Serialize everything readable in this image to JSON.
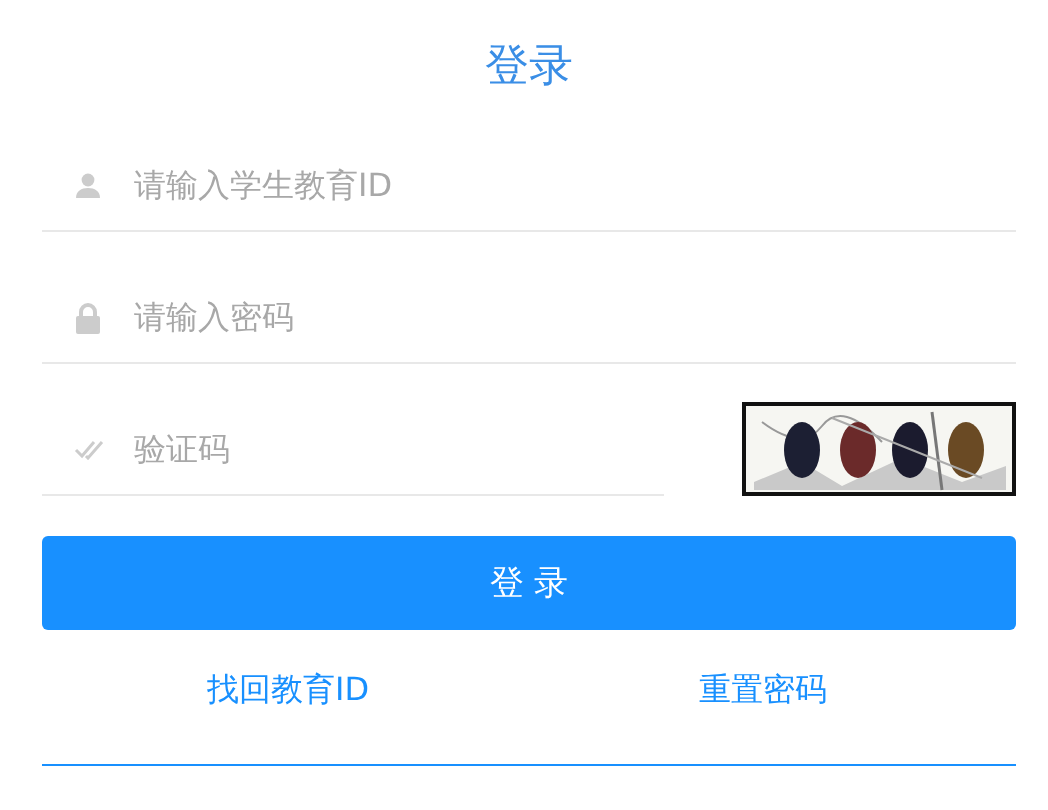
{
  "title": "登录",
  "fields": [
    {
      "kind": "user",
      "placeholder": "请输入学生教育ID"
    },
    {
      "kind": "password",
      "placeholder": "请输入密码"
    },
    {
      "kind": "captcha",
      "placeholder": "验证码"
    }
  ],
  "submit": "登 录",
  "links": [
    "找回教育ID",
    "重置密码"
  ]
}
